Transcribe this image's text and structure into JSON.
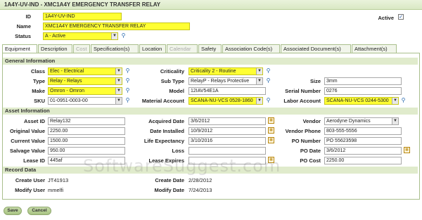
{
  "window": {
    "title": "1A4Y-UV-IND - XMC1A4Y EMERGENCY TRANSFER RELAY"
  },
  "header": {
    "id_label": "ID",
    "id_value": "1A4Y-UV-IND",
    "name_label": "Name",
    "name_value": "XMC1A4Y EMERGENCY TRANSFER RELAY",
    "status_label": "Status",
    "status_value": "A - Active",
    "active_label": "Active",
    "active_checked": "✓"
  },
  "tabs": [
    "Equipment",
    "Description",
    "Cost",
    "Specification(s)",
    "Location",
    "Calendar",
    "Safety",
    "Association Code(s)",
    "Associated Document(s)",
    "Attachment(s)"
  ],
  "sections": {
    "general": "General Information",
    "asset": "Asset Information",
    "record": "Record Data"
  },
  "general": {
    "class_label": "Class",
    "class_value": "Elec - Electrical",
    "type_label": "Type",
    "type_value": "Relay - Relays",
    "make_label": "Make",
    "make_value": "Omron - Omron",
    "sku_label": "SKU",
    "sku_value": "01-0951-0003-00",
    "criticality_label": "Criticality",
    "criticality_value": "Criticality 2 - Routine",
    "subtype_label": "Sub Type",
    "subtype_value": "RelayP - Relays Protective",
    "model_label": "Model",
    "model_value": "12IAV54E1A",
    "material_label": "Material Account",
    "material_value": "SCANA-NU-VCS 0528-1860",
    "size_label": "Size",
    "size_value": "3mm",
    "serial_label": "Serial Number",
    "serial_value": "0276",
    "labor_label": "Labor Account",
    "labor_value": "SCANA-NU-VCS 0244-5300"
  },
  "asset": {
    "assetid_label": "Asset ID",
    "assetid_value": "Relay132",
    "origval_label": "Original Value",
    "origval_value": "2250.00",
    "curval_label": "Current Value",
    "curval_value": "1500.00",
    "salvage_label": "Salvage Value",
    "salvage_value": "950.00",
    "lease_label": "Lease ID",
    "lease_value": "445af",
    "acqdate_label": "Acquired Date",
    "acqdate_value": "3/6/2012",
    "installed_label": "Date Installed",
    "installed_value": "10/9/2012",
    "lifeexp_label": "Life Expectancy",
    "lifeexp_value": "3/10/2016",
    "loss_label": "Loss",
    "loss_value": "",
    "leaseexp_label": "Lease Expires",
    "leaseexp_value": "",
    "vendor_label": "Vendor",
    "vendor_value": "Aerodyne Dynamics",
    "vphone_label": "Vendor Phone",
    "vphone_value": "803-555-5556",
    "ponum_label": "PO Number",
    "ponum_value": "PO 55623598",
    "podate_label": "PO Date",
    "podate_value": "3/6/2012",
    "pocost_label": "PO Cost",
    "pocost_value": "2250.00"
  },
  "record": {
    "cuser_label": "Create User",
    "cuser_value": "JT41913",
    "muser_label": "Modify User",
    "muser_value": "mmelfi",
    "cdate_label": "Create Date",
    "cdate_value": "2/28/2012",
    "mdate_label": "Modify Date",
    "mdate_value": "7/24/2013"
  },
  "buttons": {
    "save": "Save",
    "cancel": "Cancel"
  },
  "watermark": "SoftwareSuggest.com",
  "icons": {
    "lookup": "lookup-icon",
    "calendar": "calendar-icon",
    "dropdown": "chevron-down-icon"
  },
  "colors": {
    "required_field": "#ffff33",
    "header_bg": "#d9e8c4",
    "section_bg": "#e0ebcc"
  }
}
